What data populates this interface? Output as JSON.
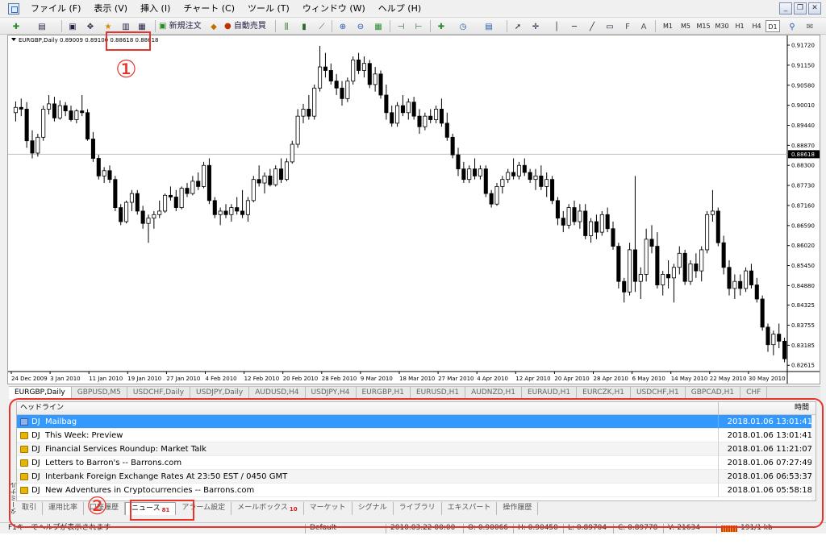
{
  "menu": {
    "items": [
      "ファイル (F)",
      "表示 (V)",
      "挿入 (I)",
      "チャート (C)",
      "ツール (T)",
      "ウィンドウ (W)",
      "ヘルプ (H)"
    ]
  },
  "toolbar": {
    "new_order_label": "新規注文",
    "auto_trade_label": "自動売買",
    "timeframes": [
      "M1",
      "M5",
      "M15",
      "M30",
      "H1",
      "H4",
      "D1"
    ],
    "active_timeframe": "D1"
  },
  "chart": {
    "info_line": "EURGBP,Daily 0.89009 0.89100 0.88618 0.88618",
    "current_price": "0.88618",
    "price_labels": [
      "0.91720",
      "0.91150",
      "0.90580",
      "0.90010",
      "0.89440",
      "0.88870",
      "0.88300",
      "0.87730",
      "0.87160",
      "0.86590",
      "0.86020",
      "0.85450",
      "0.84880",
      "0.84325",
      "0.83755",
      "0.83185",
      "0.82615"
    ],
    "date_labels": [
      "24 Dec 2009",
      "3 Jan 2010",
      "11 Jan 2010",
      "19 Jan 2010",
      "27 Jan 2010",
      "4 Feb 2010",
      "12 Feb 2010",
      "20 Feb 2010",
      "28 Feb 2010",
      "9 Mar 2010",
      "18 Mar 2010",
      "27 Mar 2010",
      "4 Apr 2010",
      "12 Apr 2010",
      "20 Apr 2010",
      "28 Apr 2010",
      "6 May 2010",
      "14 May 2010",
      "22 May 2010",
      "30 May 2010"
    ],
    "colors": {
      "bull": "#ffffff",
      "bear": "#000000",
      "wick": "#000000",
      "current_price_line": "#c0c0c0"
    }
  },
  "chart_data": {
    "type": "candlestick",
    "symbol": "EURGBP,Daily",
    "ylim": [
      0.8246,
      0.9195
    ],
    "candles": [
      [
        0.898,
        0.9012,
        0.8955,
        0.8995
      ],
      [
        0.8995,
        0.902,
        0.897,
        0.899
      ],
      [
        0.899,
        0.901,
        0.888,
        0.89
      ],
      [
        0.89,
        0.893,
        0.885,
        0.8865
      ],
      [
        0.8865,
        0.892,
        0.8855,
        0.891
      ],
      [
        0.891,
        0.9,
        0.89,
        0.899
      ],
      [
        0.899,
        0.903,
        0.8975,
        0.9005
      ],
      [
        0.9005,
        0.9025,
        0.8955,
        0.8965
      ],
      [
        0.8965,
        0.9015,
        0.896,
        0.9
      ],
      [
        0.9,
        0.901,
        0.897,
        0.8985
      ],
      [
        0.8985,
        0.9,
        0.8955,
        0.896
      ],
      [
        0.896,
        0.899,
        0.895,
        0.8985
      ],
      [
        0.8985,
        0.903,
        0.897,
        0.898
      ],
      [
        0.898,
        0.899,
        0.89,
        0.8905
      ],
      [
        0.8905,
        0.8925,
        0.884,
        0.885
      ],
      [
        0.885,
        0.886,
        0.879,
        0.88
      ],
      [
        0.88,
        0.8825,
        0.878,
        0.8815
      ],
      [
        0.8815,
        0.883,
        0.878,
        0.879
      ],
      [
        0.879,
        0.88,
        0.87,
        0.871
      ],
      [
        0.871,
        0.872,
        0.866,
        0.867
      ],
      [
        0.867,
        0.873,
        0.8665,
        0.8725
      ],
      [
        0.8725,
        0.876,
        0.87,
        0.875
      ],
      [
        0.875,
        0.876,
        0.869,
        0.87
      ],
      [
        0.87,
        0.8715,
        0.865,
        0.8665
      ],
      [
        0.8665,
        0.869,
        0.861,
        0.868
      ],
      [
        0.868,
        0.87,
        0.865,
        0.869
      ],
      [
        0.869,
        0.873,
        0.868,
        0.87
      ],
      [
        0.87,
        0.875,
        0.8695,
        0.8745
      ],
      [
        0.8745,
        0.877,
        0.873,
        0.874
      ],
      [
        0.874,
        0.876,
        0.87,
        0.871
      ],
      [
        0.871,
        0.877,
        0.8705,
        0.8765
      ],
      [
        0.8765,
        0.878,
        0.874,
        0.875
      ],
      [
        0.875,
        0.88,
        0.8745,
        0.8785
      ],
      [
        0.8785,
        0.881,
        0.876,
        0.877
      ],
      [
        0.877,
        0.884,
        0.8765,
        0.883
      ],
      [
        0.883,
        0.885,
        0.872,
        0.873
      ],
      [
        0.873,
        0.874,
        0.868,
        0.869
      ],
      [
        0.869,
        0.871,
        0.866,
        0.87
      ],
      [
        0.87,
        0.872,
        0.868,
        0.869
      ],
      [
        0.869,
        0.872,
        0.867,
        0.871
      ],
      [
        0.871,
        0.874,
        0.869,
        0.87
      ],
      [
        0.87,
        0.876,
        0.868,
        0.869
      ],
      [
        0.869,
        0.874,
        0.867,
        0.873
      ],
      [
        0.873,
        0.88,
        0.8725,
        0.879
      ],
      [
        0.879,
        0.883,
        0.877,
        0.878
      ],
      [
        0.878,
        0.881,
        0.875,
        0.88
      ],
      [
        0.88,
        0.882,
        0.877,
        0.8775
      ],
      [
        0.8775,
        0.883,
        0.877,
        0.882
      ],
      [
        0.882,
        0.885,
        0.878,
        0.879
      ],
      [
        0.879,
        0.885,
        0.8785,
        0.884
      ],
      [
        0.884,
        0.89,
        0.8835,
        0.889
      ],
      [
        0.889,
        0.899,
        0.888,
        0.897
      ],
      [
        0.897,
        0.9005,
        0.895,
        0.899
      ],
      [
        0.899,
        0.903,
        0.896,
        0.897
      ],
      [
        0.897,
        0.906,
        0.896,
        0.905
      ],
      [
        0.905,
        0.917,
        0.904,
        0.911
      ],
      [
        0.911,
        0.915,
        0.908,
        0.91
      ],
      [
        0.91,
        0.912,
        0.906,
        0.907
      ],
      [
        0.907,
        0.909,
        0.903,
        0.905
      ],
      [
        0.905,
        0.907,
        0.9,
        0.902
      ],
      [
        0.902,
        0.908,
        0.901,
        0.907
      ],
      [
        0.907,
        0.914,
        0.906,
        0.913
      ],
      [
        0.913,
        0.915,
        0.909,
        0.91
      ],
      [
        0.91,
        0.914,
        0.908,
        0.912
      ],
      [
        0.912,
        0.913,
        0.905,
        0.906
      ],
      [
        0.906,
        0.911,
        0.904,
        0.909
      ],
      [
        0.909,
        0.91,
        0.902,
        0.903
      ],
      [
        0.903,
        0.906,
        0.896,
        0.898
      ],
      [
        0.898,
        0.9,
        0.894,
        0.895
      ],
      [
        0.895,
        0.901,
        0.894,
        0.9
      ],
      [
        0.9,
        0.903,
        0.897,
        0.898
      ],
      [
        0.898,
        0.902,
        0.896,
        0.901
      ],
      [
        0.901,
        0.9025,
        0.896,
        0.897
      ],
      [
        0.897,
        0.899,
        0.892,
        0.894
      ],
      [
        0.894,
        0.898,
        0.893,
        0.897
      ],
      [
        0.897,
        0.899,
        0.895,
        0.896
      ],
      [
        0.896,
        0.9,
        0.895,
        0.899
      ],
      [
        0.899,
        0.902,
        0.894,
        0.895
      ],
      [
        0.895,
        0.898,
        0.89,
        0.891
      ],
      [
        0.891,
        0.892,
        0.885,
        0.886
      ],
      [
        0.886,
        0.888,
        0.88,
        0.882
      ],
      [
        0.882,
        0.884,
        0.878,
        0.879
      ],
      [
        0.879,
        0.883,
        0.878,
        0.882
      ],
      [
        0.882,
        0.885,
        0.879,
        0.88
      ],
      [
        0.88,
        0.883,
        0.879,
        0.882
      ],
      [
        0.882,
        0.883,
        0.874,
        0.875
      ],
      [
        0.875,
        0.876,
        0.871,
        0.872
      ],
      [
        0.872,
        0.878,
        0.8715,
        0.877
      ],
      [
        0.877,
        0.88,
        0.875,
        0.879
      ],
      [
        0.879,
        0.882,
        0.878,
        0.881
      ],
      [
        0.881,
        0.885,
        0.879,
        0.88
      ],
      [
        0.88,
        0.884,
        0.879,
        0.883
      ],
      [
        0.883,
        0.885,
        0.88,
        0.881
      ],
      [
        0.881,
        0.882,
        0.878,
        0.879
      ],
      [
        0.879,
        0.882,
        0.876,
        0.88
      ],
      [
        0.88,
        0.883,
        0.876,
        0.877
      ],
      [
        0.877,
        0.881,
        0.874,
        0.879
      ],
      [
        0.879,
        0.88,
        0.872,
        0.873
      ],
      [
        0.873,
        0.874,
        0.866,
        0.868
      ],
      [
        0.868,
        0.87,
        0.864,
        0.866
      ],
      [
        0.866,
        0.872,
        0.865,
        0.871
      ],
      [
        0.871,
        0.873,
        0.866,
        0.867
      ],
      [
        0.867,
        0.872,
        0.865,
        0.87
      ],
      [
        0.87,
        0.872,
        0.862,
        0.863
      ],
      [
        0.863,
        0.868,
        0.861,
        0.867
      ],
      [
        0.867,
        0.869,
        0.862,
        0.864
      ],
      [
        0.864,
        0.87,
        0.863,
        0.869
      ],
      [
        0.869,
        0.871,
        0.864,
        0.865
      ],
      [
        0.865,
        0.867,
        0.859,
        0.86
      ],
      [
        0.86,
        0.861,
        0.848,
        0.85
      ],
      [
        0.85,
        0.851,
        0.844,
        0.847
      ],
      [
        0.847,
        0.861,
        0.846,
        0.859
      ],
      [
        0.859,
        0.88,
        0.847,
        0.85
      ],
      [
        0.85,
        0.854,
        0.845,
        0.852
      ],
      [
        0.852,
        0.865,
        0.85,
        0.862
      ],
      [
        0.862,
        0.866,
        0.858,
        0.86
      ],
      [
        0.86,
        0.864,
        0.848,
        0.849
      ],
      [
        0.849,
        0.853,
        0.846,
        0.852
      ],
      [
        0.852,
        0.856,
        0.848,
        0.851
      ],
      [
        0.851,
        0.855,
        0.844,
        0.854
      ],
      [
        0.854,
        0.86,
        0.852,
        0.858
      ],
      [
        0.858,
        0.859,
        0.849,
        0.85
      ],
      [
        0.85,
        0.856,
        0.849,
        0.855
      ],
      [
        0.855,
        0.858,
        0.851,
        0.853
      ],
      [
        0.853,
        0.86,
        0.85,
        0.859
      ],
      [
        0.859,
        0.87,
        0.858,
        0.869
      ],
      [
        0.869,
        0.876,
        0.867,
        0.87
      ],
      [
        0.87,
        0.871,
        0.86,
        0.861
      ],
      [
        0.861,
        0.863,
        0.852,
        0.854
      ],
      [
        0.854,
        0.856,
        0.846,
        0.848
      ],
      [
        0.848,
        0.852,
        0.845,
        0.85
      ],
      [
        0.85,
        0.852,
        0.846,
        0.848
      ],
      [
        0.848,
        0.854,
        0.847,
        0.853
      ],
      [
        0.853,
        0.855,
        0.848,
        0.849
      ],
      [
        0.849,
        0.851,
        0.844,
        0.845
      ],
      [
        0.845,
        0.846,
        0.836,
        0.837
      ],
      [
        0.837,
        0.838,
        0.83,
        0.832
      ],
      [
        0.832,
        0.836,
        0.829,
        0.835
      ],
      [
        0.835,
        0.838,
        0.831,
        0.833
      ],
      [
        0.833,
        0.834,
        0.827,
        0.828
      ]
    ]
  },
  "symbol_tabs": {
    "items": [
      "EURGBP,Daily",
      "GBPUSD,M5",
      "USDCHF,Daily",
      "USDJPY,Daily",
      "AUDUSD,H4",
      "USDJPY,H4",
      "EURGBP,H1",
      "EURUSD,H1",
      "AUDNZD,H1",
      "EURAUD,H1",
      "EURCZK,H1",
      "USDCHF,H1",
      "GBPCAD,H1",
      "CHF"
    ],
    "active_index": 0
  },
  "news": {
    "col_headline": "ヘッドライン",
    "col_time": "時間",
    "rows": [
      {
        "source": "DJ",
        "headline": "Mailbag",
        "time": "2018.01.06 13:01:41"
      },
      {
        "source": "DJ",
        "headline": "This Week: Preview",
        "time": "2018.01.06 13:01:41"
      },
      {
        "source": "DJ",
        "headline": "Financial Services Roundup: Market Talk",
        "time": "2018.01.06 11:21:07"
      },
      {
        "source": "DJ",
        "headline": "Letters to Barron's -- Barrons.com",
        "time": "2018.01.06 07:27:49"
      },
      {
        "source": "DJ",
        "headline": "Interbank Foreign Exchange Rates At 23:50 EST / 0450 GMT",
        "time": "2018.01.06 06:53:37"
      },
      {
        "source": "DJ",
        "headline": "New Adventures in Cryptocurrencies -- Barrons.com",
        "time": "2018.01.06 05:58:18"
      }
    ],
    "selected_index": 0
  },
  "side_label": "ターミナル",
  "bottom_tabs": {
    "items": [
      {
        "label": "取引",
        "badge": ""
      },
      {
        "label": "運用比率",
        "badge": ""
      },
      {
        "label": "口座履歴",
        "badge": ""
      },
      {
        "label": "ニュース",
        "badge": "81"
      },
      {
        "label": "アラーム設定",
        "badge": ""
      },
      {
        "label": "メールボックス",
        "badge": "10"
      },
      {
        "label": "マーケット",
        "badge": ""
      },
      {
        "label": "シグナル",
        "badge": ""
      },
      {
        "label": "ライブラリ",
        "badge": ""
      },
      {
        "label": "エキスパート",
        "badge": ""
      },
      {
        "label": "操作履歴",
        "badge": ""
      }
    ],
    "active_index": 3
  },
  "status": {
    "help": "F1キーでヘルプが表示されます",
    "profile": "Default",
    "datetime": "2010.03.22 00:00",
    "open": "O: 0.90066",
    "high": "H: 0.90450",
    "low": "L: 0.89704",
    "close": "C: 0.89778",
    "volume": "V: 21634",
    "traffic": "191/1 kb"
  },
  "annotations": {
    "mark1": "①",
    "mark2": "②"
  }
}
